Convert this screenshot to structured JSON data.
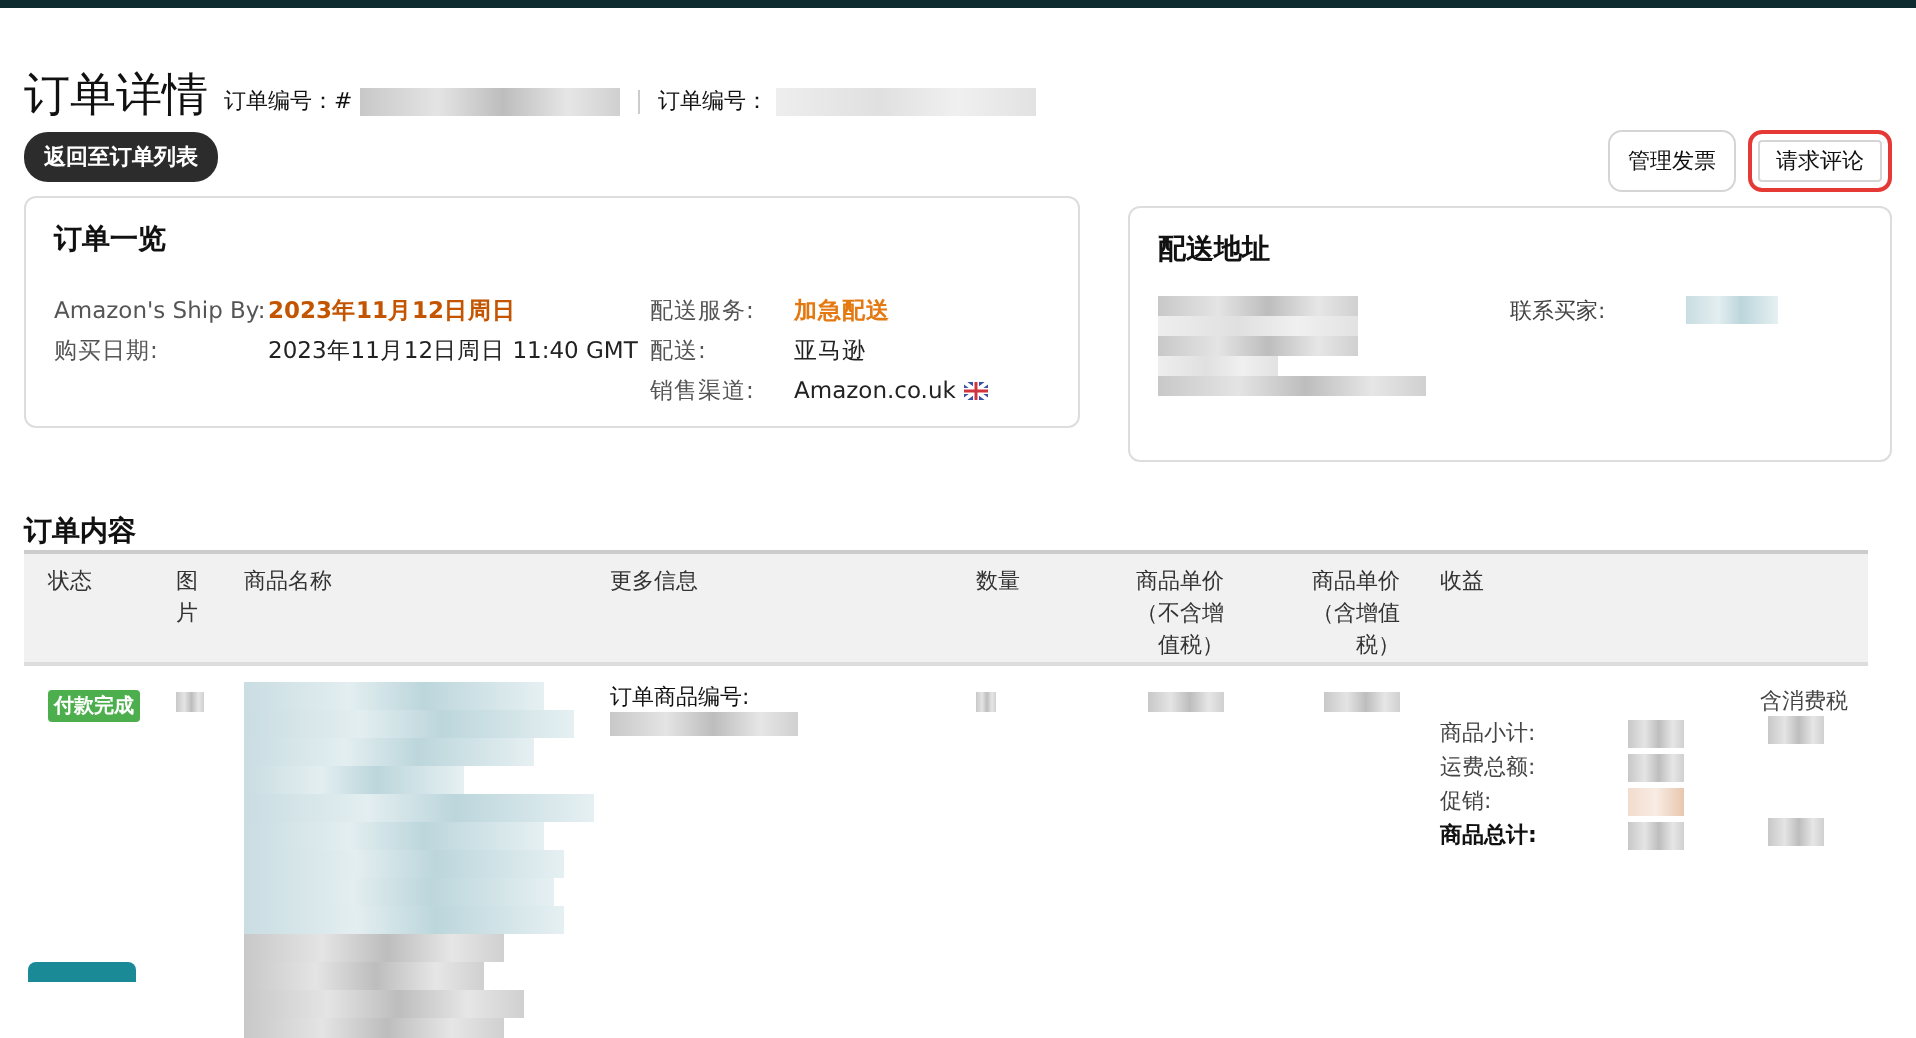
{
  "header": {
    "title": "订单详情",
    "order_labels": [
      "订单编号：#",
      "订单编号："
    ],
    "back_button": "返回至订单列表"
  },
  "actions": [
    {
      "label": "管理发票",
      "highlighted": false
    },
    {
      "label": "请求评论",
      "highlighted": true
    }
  ],
  "order_summary": {
    "title": "订单一览",
    "columns": [
      [
        {
          "label": "Amazon's Ship By:",
          "value": "2023年11月12日周日",
          "color": "#c45500",
          "bold": true,
          "flag": false
        },
        {
          "label": "购买日期:",
          "value": "2023年11月12日周日 11:40 GMT",
          "color": "#222222",
          "bold": false,
          "flag": false
        }
      ],
      [
        {
          "label": "配送服务:",
          "value": "加急配送",
          "color": "#e47911",
          "bold": true,
          "flag": false
        },
        {
          "label": "配送:",
          "value": "亚马逊",
          "color": "#222222",
          "bold": false,
          "flag": false
        },
        {
          "label": "销售渠道:",
          "value": "Amazon.co.uk",
          "color": "#222222",
          "bold": false,
          "flag": true
        }
      ]
    ]
  },
  "shipping_address": {
    "title": "配送地址",
    "contact_label": "联系买家:"
  },
  "order_contents": {
    "title": "订单内容",
    "columns": [
      "状态",
      "图片",
      "商品名称",
      "更多信息",
      "数量",
      "商品单价（不含增值税）",
      "商品单价（含增值税）",
      "收益"
    ],
    "row": {
      "status": "付款完成",
      "more_info_label": "订单商品编号:",
      "totals_note": "含消费税",
      "totals": [
        {
          "label": "商品小计:",
          "bold": false
        },
        {
          "label": "运费总额:",
          "bold": false
        },
        {
          "label": "促销:",
          "bold": false
        },
        {
          "label": "商品总计:",
          "bold": true
        }
      ]
    }
  }
}
